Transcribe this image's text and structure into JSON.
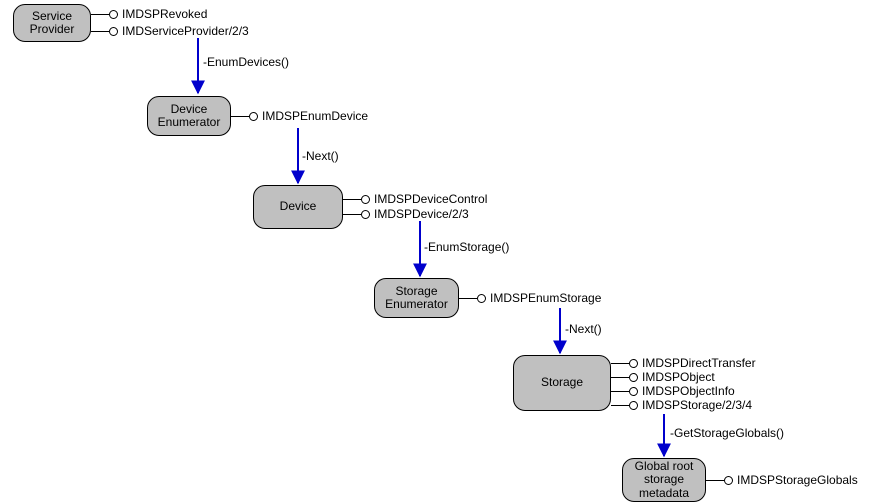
{
  "nodes": {
    "sp": {
      "label": "Service\nProvider"
    },
    "de": {
      "label": "Device\nEnumerator"
    },
    "dev": {
      "label": "Device"
    },
    "se": {
      "label": "Storage\nEnumerator"
    },
    "stor": {
      "label": "Storage"
    },
    "glob": {
      "label": "Global root\nstorage\nmetadata"
    }
  },
  "interfaces": {
    "sp1": "IMDSPRevoked",
    "sp2": "IMDServiceProvider/2/3",
    "de1": "IMDSPEnumDevice",
    "dev1": "IMDSPDeviceControl",
    "dev2": "IMDSPDevice/2/3",
    "se1": "IMDSPEnumStorage",
    "st1": "IMDSPDirectTransfer",
    "st2": "IMDSPObject",
    "st3": "IMDSPObjectInfo",
    "st4": "IMDSPStorage/2/3/4",
    "gl1": "IMDSPStorageGlobals"
  },
  "methods": {
    "m1": "-EnumDevices()",
    "m2": "-Next()",
    "m3": "-EnumStorage()",
    "m4": "-Next()",
    "m5": "-GetStorageGlobals()"
  }
}
